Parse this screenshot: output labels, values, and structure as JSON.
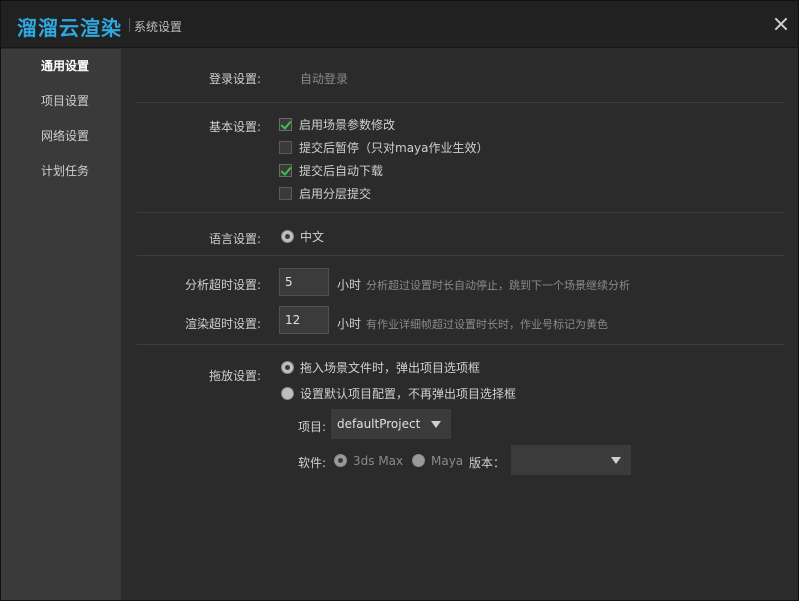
{
  "titlebar": {
    "logo": "溜溜云渲染",
    "title": "系统设置"
  },
  "sidebar": {
    "items": [
      {
        "label": "通用设置",
        "active": true
      },
      {
        "label": "项目设置",
        "active": false
      },
      {
        "label": "网络设置",
        "active": false
      },
      {
        "label": "计划任务",
        "active": false
      }
    ]
  },
  "login": {
    "label": "登录设置:",
    "value": "自动登录"
  },
  "basic": {
    "label": "基本设置:",
    "options": [
      {
        "label": "启用场景参数修改",
        "checked": true
      },
      {
        "label": "提交后暂停（只对maya作业生效）",
        "checked": false
      },
      {
        "label": "提交后自动下载",
        "checked": true
      },
      {
        "label": "启用分层提交",
        "checked": false
      }
    ]
  },
  "language": {
    "label": "语言设置:",
    "option": "中文"
  },
  "analysis_timeout": {
    "label": "分析超时设置:",
    "value": "5",
    "unit": "小时",
    "hint": "分析超过设置时长自动停止，跳到下一个场景继续分析"
  },
  "render_timeout": {
    "label": "渲染超时设置:",
    "value": "12",
    "unit": "小时",
    "hint": "有作业详细帧超过设置时长时，作业号标记为黄色"
  },
  "drag": {
    "label": "拖放设置:",
    "options": [
      {
        "label": "拖入场景文件时，弹出项目选项框",
        "selected": true
      },
      {
        "label": "设置默认项目配置，不再弹出项目选择框",
        "selected": false
      }
    ],
    "project_label": "项目:",
    "project_value": "defaultProject",
    "software_label": "软件:",
    "software_options": [
      "3ds Max",
      "Maya"
    ],
    "version_label": "版本：",
    "version_value": ""
  },
  "colors": {
    "accent": "#2fa8e0",
    "check": "#39c24a"
  }
}
